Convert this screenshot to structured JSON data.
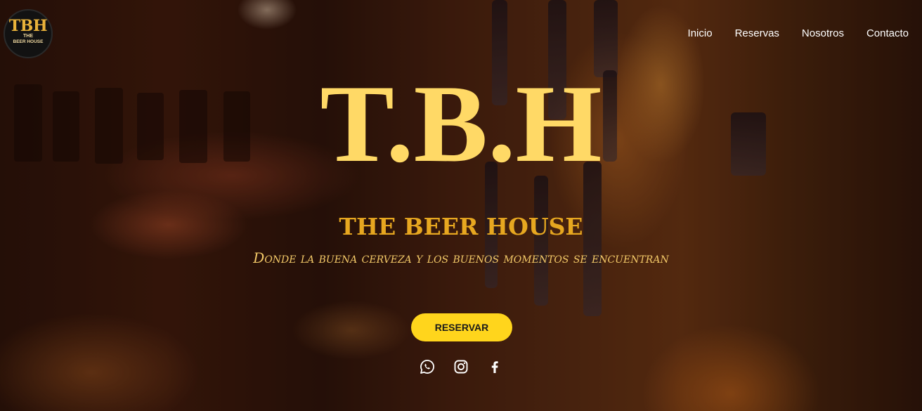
{
  "brand": {
    "logo_main": "TBH",
    "logo_small": "THE",
    "logo_sub": "BEER HOUSE"
  },
  "nav": {
    "items": [
      {
        "label": "Inicio"
      },
      {
        "label": "Reservas"
      },
      {
        "label": "Nosotros"
      },
      {
        "label": "Contacto"
      }
    ]
  },
  "hero": {
    "title": "T.B.H",
    "subtitle": "THE BEER HOUSE",
    "tagline": "Donde la buena cerveza y los buenos momentos se encuentran",
    "cta_label": "RESERVAR"
  },
  "social": {
    "icons": [
      "whatsapp-icon",
      "instagram-icon",
      "facebook-icon"
    ]
  },
  "colors": {
    "title": "#ffd966",
    "subtitle": "#e7a720",
    "tagline": "#f3c968",
    "button_bg": "#ffd51c",
    "button_text": "#1a1a1a",
    "nav_text": "#ffffff"
  }
}
